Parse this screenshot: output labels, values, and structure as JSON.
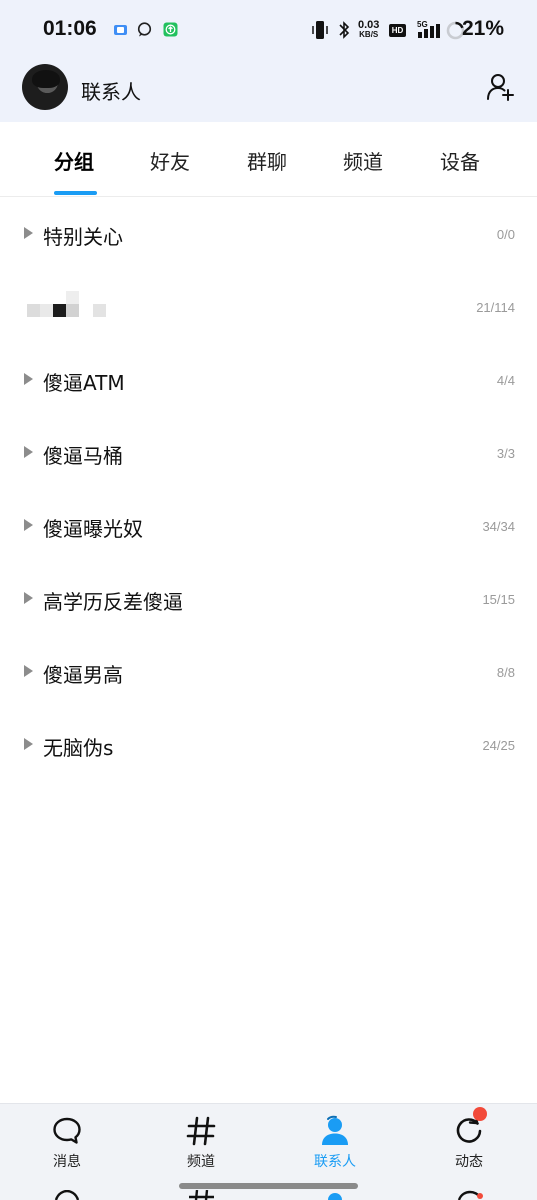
{
  "status_bar": {
    "time": "01:06",
    "net_speed_value": "0.03",
    "net_speed_unit": "KB/S",
    "hd": "HD",
    "network": "5G",
    "battery_percent": "21%"
  },
  "header": {
    "title": "联系人",
    "add_icon": "add-contact-icon"
  },
  "tabs": [
    {
      "label": "分组",
      "active": true
    },
    {
      "label": "好友",
      "active": false
    },
    {
      "label": "群聊",
      "active": false
    },
    {
      "label": "频道",
      "active": false
    },
    {
      "label": "设备",
      "active": false
    }
  ],
  "groups": [
    {
      "name": "特别关心",
      "count": "0/0"
    },
    {
      "name": "",
      "count": "21/114"
    },
    {
      "name": "傻逼ATM",
      "count": "4/4"
    },
    {
      "name": "傻逼马桶",
      "count": "3/3"
    },
    {
      "name": "傻逼曝光奴",
      "count": "34/34"
    },
    {
      "name": "高学历反差傻逼",
      "count": "15/15"
    },
    {
      "name": "傻逼男高",
      "count": "8/8"
    },
    {
      "name": "无脑伪s",
      "count": "24/25"
    }
  ],
  "bottom_nav": [
    {
      "label": "消息",
      "icon": "message-icon",
      "active": false
    },
    {
      "label": "频道",
      "icon": "hashtag-icon",
      "active": false
    },
    {
      "label": "联系人",
      "icon": "contacts-icon",
      "active": true
    },
    {
      "label": "动态",
      "icon": "refresh-icon",
      "active": false
    }
  ],
  "colors": {
    "accent": "#1a9cf4",
    "header_bg": "#eef2fb",
    "badge": "#f24a3a"
  }
}
